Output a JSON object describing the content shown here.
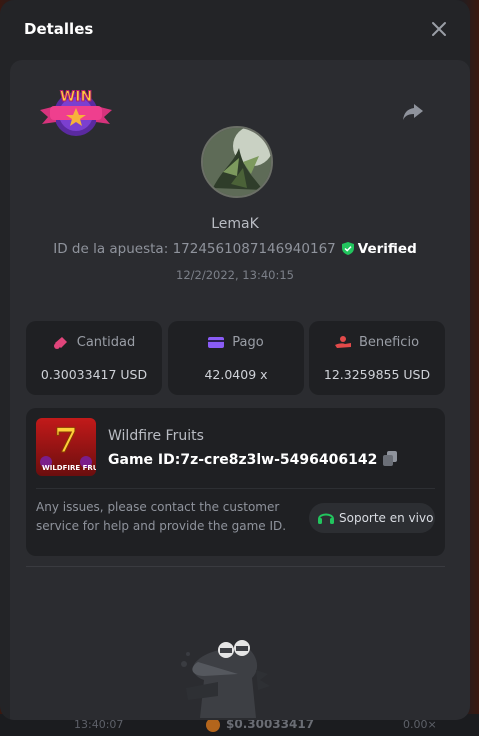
{
  "modal": {
    "title": "Detalles",
    "close_icon": "close-icon"
  },
  "badge": {
    "text": "WIN"
  },
  "player": {
    "username": "LemaK",
    "bet_id_label": "ID de la apuesta:",
    "bet_id": "1724561087146940167",
    "verified_label": "Verified",
    "datetime": "12/2/2022, 13:40:15"
  },
  "stats": [
    {
      "label": "Cantidad",
      "value": "0.30033417 USD",
      "icon": "coins-icon",
      "color": "#e0457b"
    },
    {
      "label": "Pago",
      "value": "42.0409 x",
      "icon": "wallet-icon",
      "color": "#8a5cf6"
    },
    {
      "label": "Beneficio",
      "value": "12.3259855 USD",
      "icon": "profit-hand-icon",
      "color": "#e24a4a"
    }
  ],
  "game": {
    "name": "Wildfire Fruits",
    "id_label": "Game ID:",
    "id_value": "7z-cre8z3lw-5496406142",
    "thumb_caption": "WILDFIRE FRUITS"
  },
  "support": {
    "message": "Any issues, please contact the customer service for help and provide the game ID.",
    "button_label": "Soporte en vivo"
  },
  "footer": {
    "time": "13:40:07",
    "amount": "$0.30033417",
    "multiplier": "0.00×"
  },
  "colors": {
    "accent_green": "#22c55e",
    "panel_bg": "#2b2c30",
    "card_bg": "#1f2023"
  }
}
